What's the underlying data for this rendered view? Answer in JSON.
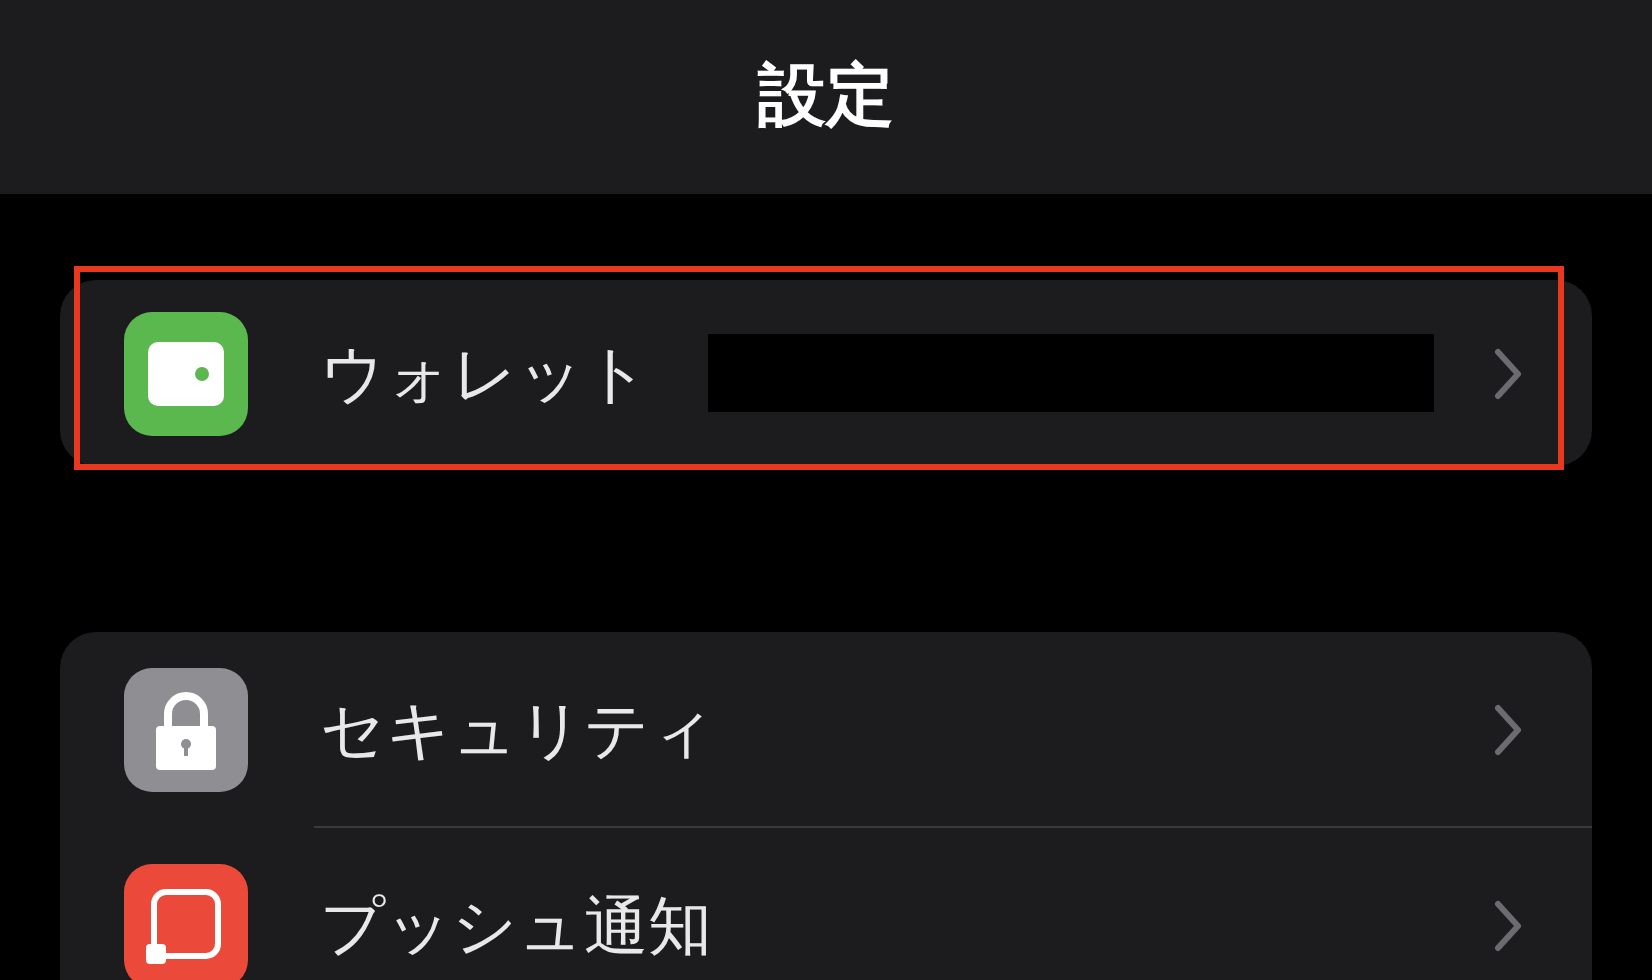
{
  "header": {
    "title": "設定"
  },
  "groups": [
    {
      "highlighted": true,
      "rows": [
        {
          "kind": "wallet",
          "label": "ウォレット",
          "redacted": true
        }
      ]
    },
    {
      "highlighted": false,
      "rows": [
        {
          "kind": "lock",
          "label": "セキュリティ",
          "redacted": false
        },
        {
          "kind": "notification",
          "label": "プッシュ通知",
          "redacted": false
        }
      ]
    }
  ]
}
